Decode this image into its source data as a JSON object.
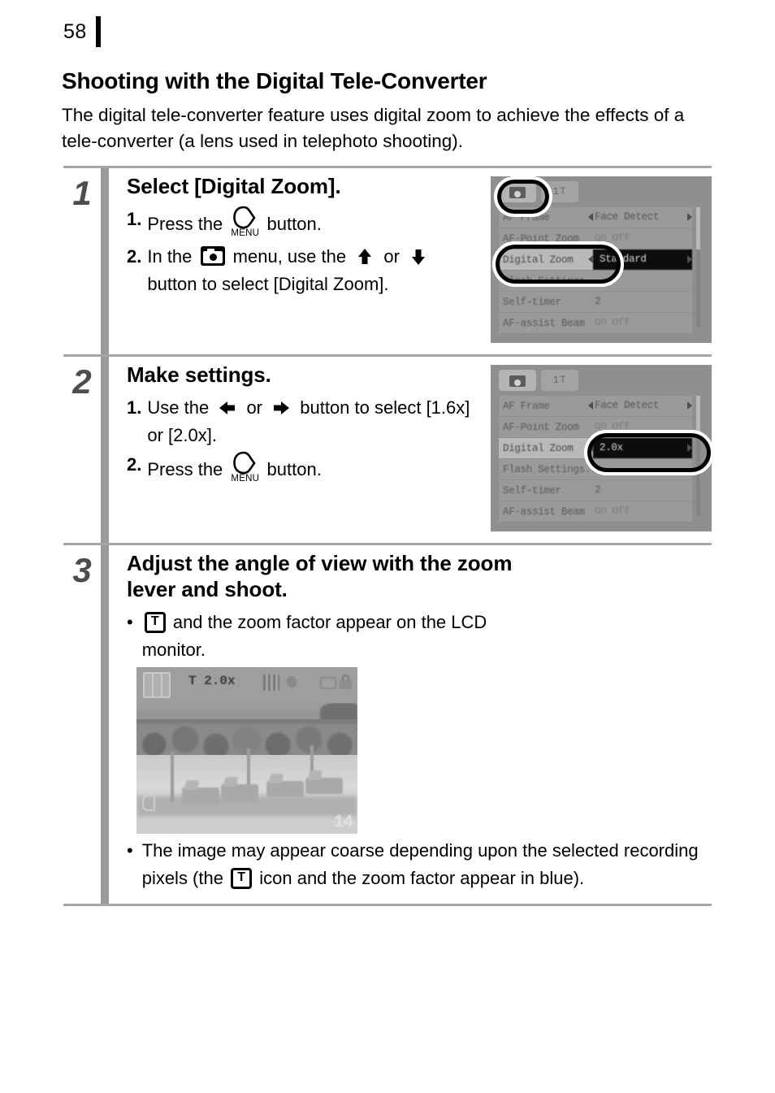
{
  "page": {
    "number": "58"
  },
  "section": {
    "title": "Shooting with the Digital Tele-Converter",
    "intro": "The digital tele-converter feature uses digital zoom to achieve the effects of a tele-converter (a lens used in telephoto shooting)."
  },
  "steps": [
    {
      "number": "1",
      "heading": "Select [Digital Zoom].",
      "items": [
        {
          "marker": "1.",
          "before": "Press the",
          "icon": "menu-button-icon",
          "after": "button."
        },
        {
          "marker": "2.",
          "before": "In the",
          "icon": "camera-menu-icon",
          "mid1": "menu, use the",
          "icon2": "up-arrow-icon",
          "mid2": "or",
          "icon3": "down-arrow-icon",
          "after": "button to select [Digital Zoom]."
        }
      ],
      "figure": {
        "type": "camera-lcd-menu",
        "tabs": [
          "camera-tab",
          "tools-tab"
        ],
        "tools_tab_label": "1T",
        "rows": [
          {
            "label": "AF Frame",
            "value": "Face Detect",
            "carets": true,
            "selected": false,
            "boxed": false
          },
          {
            "label": "AF-Point Zoom",
            "value": "On Off",
            "carets": false,
            "selected": false,
            "boxed": false
          },
          {
            "label": "Digital Zoom",
            "value": "Standard",
            "carets": true,
            "selected": true,
            "boxed": true
          },
          {
            "label": "Flash Settings...",
            "value": "",
            "carets": false,
            "selected": false,
            "boxed": false
          },
          {
            "label": "Self-timer",
            "value": "2",
            "carets": false,
            "selected": false,
            "boxed": false
          },
          {
            "label": "AF-assist Beam",
            "value": "On Off",
            "carets": false,
            "selected": false,
            "boxed": false
          }
        ],
        "highlights": [
          "camera-tab",
          "digital-zoom-row"
        ]
      }
    },
    {
      "number": "2",
      "heading": "Make settings.",
      "items": [
        {
          "marker": "1.",
          "before": "Use the",
          "icon": "left-arrow-icon",
          "mid1": "or",
          "icon2": "right-arrow-icon",
          "after": "button to select [1.6x] or [2.0x]."
        },
        {
          "marker": "2.",
          "before": "Press the",
          "icon": "menu-button-icon",
          "after": "button."
        }
      ],
      "figure": {
        "type": "camera-lcd-menu",
        "tabs": [
          "camera-tab",
          "tools-tab"
        ],
        "tools_tab_label": "1T",
        "rows": [
          {
            "label": "AF Frame",
            "value": "Face Detect",
            "carets": true,
            "selected": false,
            "boxed": false
          },
          {
            "label": "AF-Point Zoom",
            "value": "On Off",
            "carets": false,
            "selected": false,
            "boxed": false
          },
          {
            "label": "Digital Zoom",
            "value": "2.0x",
            "carets": true,
            "selected": true,
            "boxed": true
          },
          {
            "label": "Flash Settings...",
            "value": "",
            "carets": false,
            "selected": false,
            "boxed": false
          },
          {
            "label": "Self-timer",
            "value": "2",
            "carets": false,
            "selected": false,
            "boxed": false
          },
          {
            "label": "AF-assist Beam",
            "value": "On Off",
            "carets": false,
            "selected": false,
            "boxed": false
          }
        ],
        "highlights": [
          "digital-zoom-value"
        ]
      }
    },
    {
      "number": "3",
      "heading": "Adjust the angle of view with the zoom lever and shoot.",
      "items": [
        {
          "marker": "•",
          "icon": "tele-t-icon",
          "after": "and the zoom factor appear on the LCD monitor."
        },
        {
          "marker": "•",
          "before": "The image may appear coarse depending upon the selected recording pixels (the",
          "icon": "tele-t-icon",
          "after": "icon and the zoom factor appear in blue)."
        }
      ],
      "figure": {
        "type": "camera-lcd-photo",
        "scene": "beach-with-umbrellas-and-loungers",
        "osd_zoom": "T 2.0x",
        "shots_remaining": "14"
      }
    }
  ]
}
